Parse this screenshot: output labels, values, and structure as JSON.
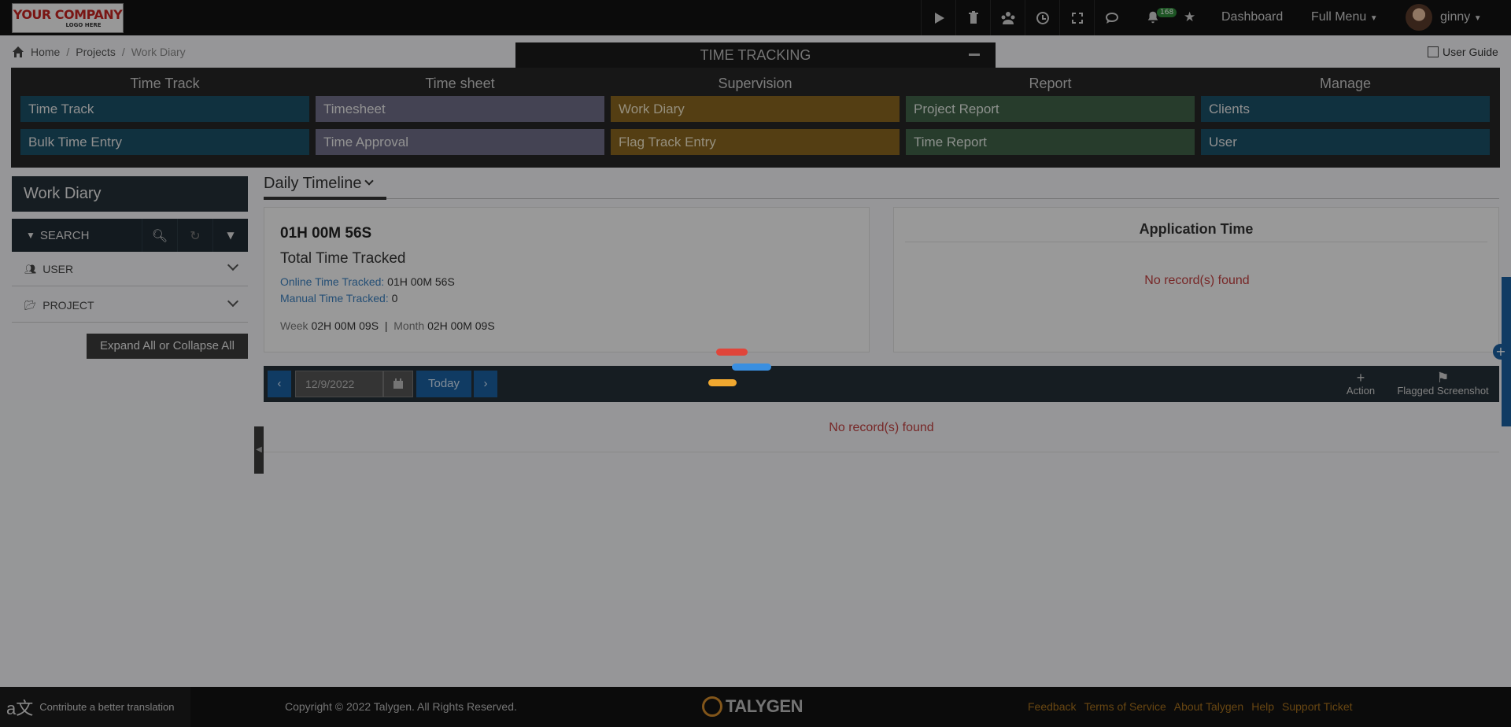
{
  "header": {
    "logo_line1": "YOUR COMPANY",
    "logo_line2": "LOGO HERE",
    "notification_count": "168",
    "dashboard_label": "Dashboard",
    "full_menu_label": "Full Menu",
    "user_name": "ginny",
    "icons": [
      "play-icon",
      "trash-icon",
      "team-icon",
      "clock-icon",
      "fullscreen-icon",
      "chat-icon",
      "bell-icon",
      "star-icon"
    ]
  },
  "breadcrumb": {
    "home": "Home",
    "projects": "Projects",
    "current": "Work Diary",
    "sep": "/"
  },
  "module_title": "TIME TRACKING",
  "user_guide_label": "User Guide",
  "modules": [
    {
      "header": "Time Track",
      "items": [
        "Time Track",
        "Bulk Time Entry"
      ]
    },
    {
      "header": "Time sheet",
      "items": [
        "Timesheet",
        "Time Approval"
      ]
    },
    {
      "header": "Supervision",
      "items": [
        "Work Diary",
        "Flag Track Entry"
      ]
    },
    {
      "header": "Report",
      "items": [
        "Project Report",
        "Time Report"
      ]
    },
    {
      "header": "Manage",
      "items": [
        "Clients",
        "User"
      ]
    }
  ],
  "sidebar": {
    "title": "Work Diary",
    "search_label": "SEARCH",
    "filters": [
      "USER",
      "PROJECT"
    ],
    "expand_label": "Expand All or Collapse All"
  },
  "main": {
    "view_title": "Daily Timeline",
    "total_time": "01H 00M 56S",
    "total_label": "Total Time Tracked",
    "online_label": "Online Time Tracked:",
    "online_value": "01H 00M 56S",
    "manual_label": "Manual Time Tracked:",
    "manual_value": "0",
    "week_label": "Week",
    "week_value": "02H 00M 09S",
    "month_sep": "|",
    "month_label": "Month",
    "month_value": "02H 00M 09S",
    "app_time_title": "Application Time",
    "app_no_record": "No record(s) found",
    "date_value": "12/9/2022",
    "prev_label": "‹",
    "next_label": "›",
    "today_label": "Today",
    "action_label": "Action",
    "flagged_label": "Flagged Screenshot",
    "timeline_no_record": "No record(s) found"
  },
  "footer": {
    "translate_label": "Contribute a better translation",
    "copyright": "Copyright © 2022 Talygen. All Rights Reserved.",
    "brand": "TALYGEN",
    "links": [
      "Feedback",
      "Terms of Service",
      "About Talygen",
      "Help",
      "Support Ticket"
    ]
  },
  "colors": {
    "module_blue": "#1a4f66",
    "module_purple": "#6e6c86",
    "module_yellow": "#886520",
    "module_green": "#3f6147",
    "primary": "#1a5fa0",
    "loader_red": "#e0453a",
    "loader_blue": "#3a8fe0",
    "loader_yellow": "#f0a830"
  }
}
